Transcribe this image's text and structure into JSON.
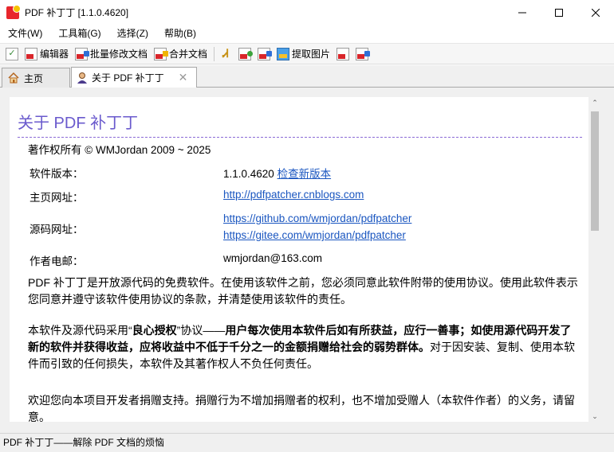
{
  "window": {
    "title": "PDF 补丁丁 [1.1.0.4620]"
  },
  "menu": {
    "items": [
      "文件(W)",
      "工具箱(G)",
      "选择(Z)",
      "帮助(B)"
    ]
  },
  "toolbar": {
    "editor_label": "编辑器",
    "batch_modify_label": "批量修改文档",
    "merge_label": "合并文档",
    "extract_images_label": "提取图片"
  },
  "tabs": {
    "home_label": "主页",
    "about_label": "关于 PDF 补丁丁"
  },
  "about": {
    "title": "关于 PDF 补丁丁",
    "copyright": "著作权所有 © WMJordan 2009 ~ 2025",
    "version_label": "软件版本：",
    "version_value": "1.1.0.4620",
    "check_update": "检查新版本",
    "homepage_label": "主页网址：",
    "homepage_url": "http://pdfpatcher.cnblogs.com",
    "source_label": "源码网址：",
    "source_url_1": "https://github.com/wmjordan/pdfpatcher",
    "source_url_2": "https://gitee.com/wmjordan/pdfpatcher",
    "email_label": "作者电邮：",
    "email_value": "wmjordan@163.com",
    "para1": "PDF 补丁丁是开放源代码的免费软件。在使用该软件之前，您必须同意此软件附带的使用协议。使用此软件表示您同意并遵守该软件使用协议的条款，并清楚使用该软件的责任。",
    "para2_pre": "本软件及源代码采用“",
    "para2_license": "良心授权",
    "para2_mid": "”协议——",
    "para2_bold": "用户每次使用本软件后如有所获益，应行一善事；如使用源代码开发了新的软件并获得收益，应将收益中不低于千分之一的金额捐赠给社会的弱势群体。",
    "para2_post": "对于因安装、复制、使用本软件而引致的任何损失，本软件及其著作权人不负任何责任。",
    "para3": "欢迎您向本项目开发者捐赠支持。捐赠行为不增加捐赠者的权利，也不增加受赠人（本软件作者）的义务，请留意。"
  },
  "status": {
    "text": "PDF 补丁丁——解除 PDF 文档的烦恼"
  }
}
